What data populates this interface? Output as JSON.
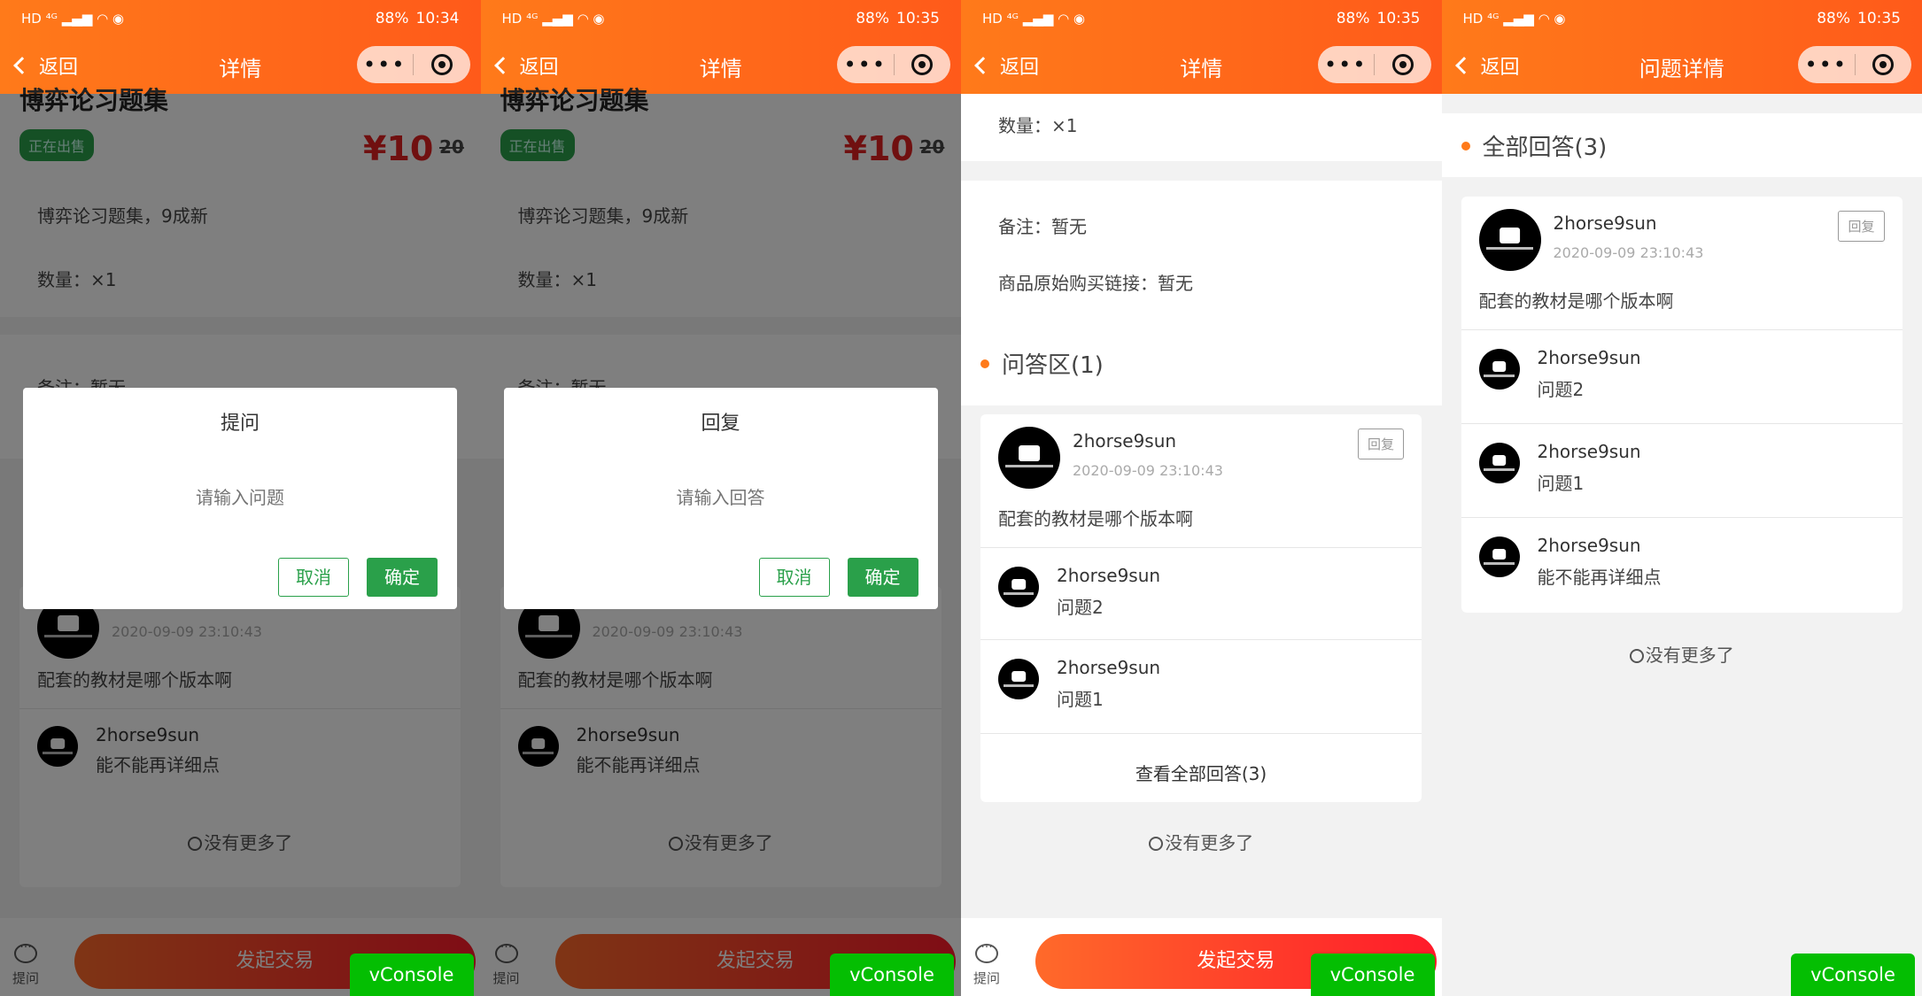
{
  "status": {
    "left_icons": "HD ⁴ᴳ ▂▄▆ ◠ ◉",
    "battery": "88%",
    "times": [
      "10:34",
      "10:35",
      "10:35",
      "10:35"
    ]
  },
  "nav": {
    "back_label": "返回",
    "title_detail": "详情",
    "title_question": "问题详情",
    "more_glyph": "•••"
  },
  "item": {
    "title_partial": "博弈论习题集",
    "badge": "正在出售",
    "price": "¥10",
    "price_old": "20",
    "description": "博弈论习题集，9成新",
    "quantity": "数量：×1",
    "remark": "备注：暂无",
    "original_link": "商品原始购买链接：暂无"
  },
  "qa": {
    "section_title": "问答区(1)",
    "all_answers_title": "全部回答(3)",
    "reply_label": "回复",
    "question": {
      "user": "2horse9sun",
      "date": "2020-09-09 23:10:43",
      "text": "配套的教材是哪个版本啊"
    },
    "answers_preview": [
      {
        "user": "2horse9sun",
        "text": "问题2"
      },
      {
        "user": "2horse9sun",
        "text": "问题1"
      }
    ],
    "answers_all": [
      {
        "user": "2horse9sun",
        "text": "问题2"
      },
      {
        "user": "2horse9sun",
        "text": "问题1"
      },
      {
        "user": "2horse9sun",
        "text": "能不能再详细点"
      }
    ],
    "dialog_answer": {
      "user": "2horse9sun",
      "text": "能不能再详细点"
    },
    "view_all": "查看全部回答(3)",
    "no_more": "没有更多了"
  },
  "dialogs": {
    "ask": {
      "title": "提问",
      "placeholder": "请输入问题"
    },
    "reply": {
      "title": "回复",
      "placeholder": "请输入回答"
    },
    "cancel": "取消",
    "confirm": "确定"
  },
  "tabbar": {
    "ask_label": "提问",
    "trade_label": "发起交易",
    "vconsole": "vConsole"
  }
}
